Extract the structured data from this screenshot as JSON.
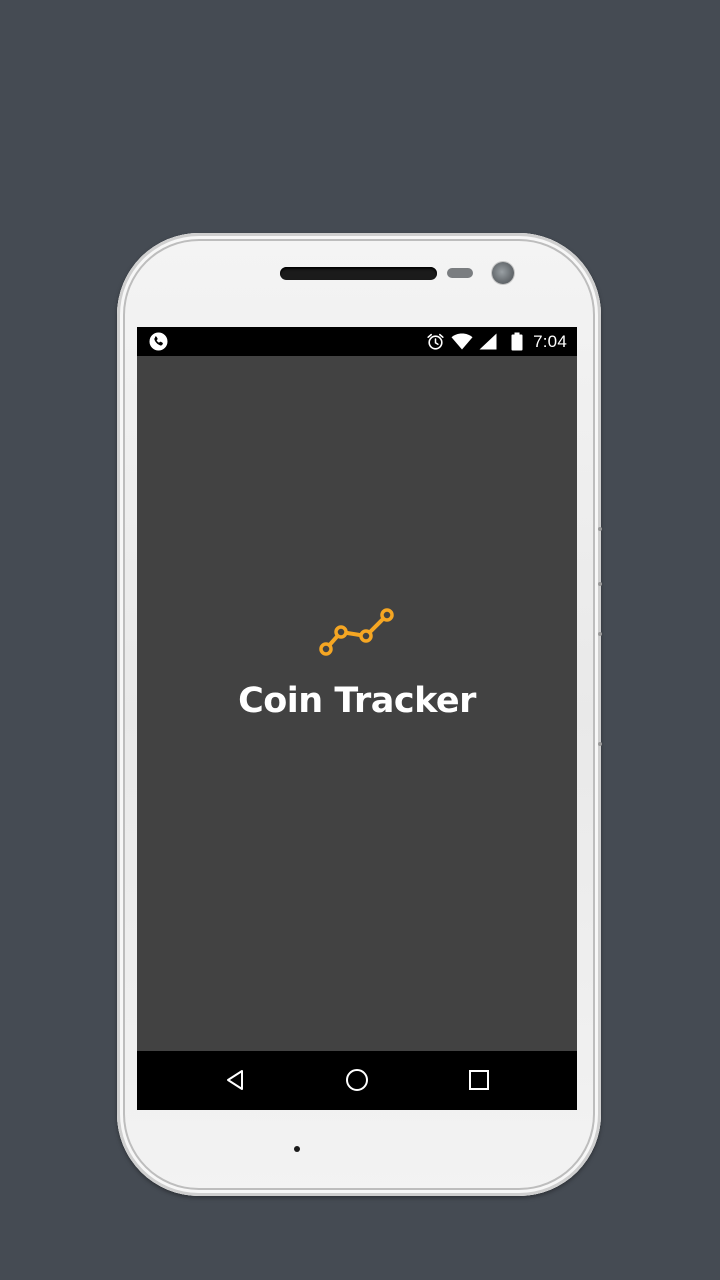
{
  "status_bar": {
    "time": "7:04",
    "left_icon": "phone-call-icon",
    "right_icons": [
      "alarm-clock-icon",
      "wifi-icon",
      "cell-signal-icon",
      "battery-icon"
    ]
  },
  "app": {
    "title": "Coin Tracker",
    "logo_icon": "trend-line-icon",
    "logo_color": "#f5a623",
    "background_color": "#424242"
  },
  "nav_bar": {
    "buttons": [
      "back-icon",
      "home-icon",
      "recents-icon"
    ]
  }
}
